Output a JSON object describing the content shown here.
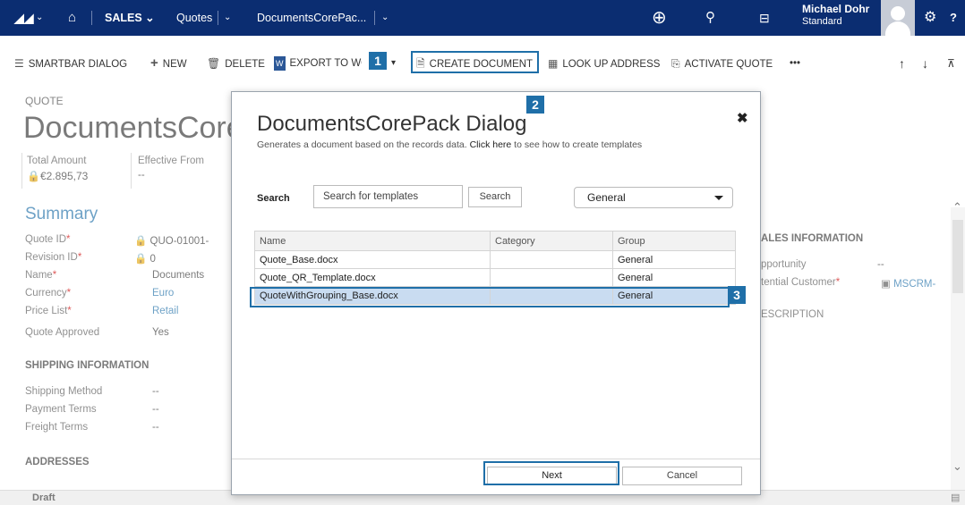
{
  "topnav": {
    "logo": "dynamics-logo",
    "home": "home-icon",
    "area": "SALES",
    "entity": "Quotes",
    "record": "DocumentsCorePac...",
    "user_name": "Michael Dohr",
    "user_role": "Standard"
  },
  "commandbar": {
    "smartbar": "SMARTBAR DIALOG",
    "new": "NEW",
    "delete": "DELETE",
    "export": "EXPORT TO WO",
    "create_document": "CREATE DOCUMENT",
    "lookup_address": "LOOK UP ADDRESS",
    "activate_quote": "ACTIVATE QUOTE",
    "more": "•••"
  },
  "callouts": {
    "one": "1",
    "two": "2",
    "three": "3"
  },
  "record": {
    "type_label": "QUOTE",
    "title": "DocumentsCore",
    "total_amount_label": "Total Amount",
    "total_amount_value": "€2.895,73",
    "effective_from_label": "Effective From",
    "effective_from_value": "--"
  },
  "summary": {
    "heading": "Summary",
    "fields": [
      {
        "label": "Quote ID",
        "value": "QUO-01001-"
      },
      {
        "label": "Revision ID",
        "value": "0"
      },
      {
        "label": "Name",
        "value": "Documents"
      },
      {
        "label": "Currency",
        "value": "Euro"
      },
      {
        "label": "Price List",
        "value": "Retail"
      },
      {
        "label": "Quote Approved",
        "value": "Yes"
      }
    ]
  },
  "shipping": {
    "heading": "SHIPPING INFORMATION",
    "fields": [
      {
        "label": "Shipping Method",
        "value": "--"
      },
      {
        "label": "Payment Terms",
        "value": "--"
      },
      {
        "label": "Freight Terms",
        "value": "--"
      }
    ]
  },
  "addresses": {
    "heading": "ADDRESSES"
  },
  "sales_info": {
    "heading": "ALES INFORMATION",
    "opportunity_label": "pportunity",
    "opportunity_value": "--",
    "customer_label": "tential Customer",
    "customer_value": "MSCRM-",
    "description_heading": "ESCRIPTION"
  },
  "status": {
    "text": "Draft"
  },
  "dialog": {
    "title": "DocumentsCorePack Dialog",
    "subtitle_pre": "Generates a document based on the records data. ",
    "subtitle_link": "Click here",
    "subtitle_post": " to see how to create templates",
    "search_label": "Search",
    "search_placeholder": "Search for templates",
    "search_button": "Search",
    "group_select": "General",
    "columns": [
      "Name",
      "Category",
      "Group"
    ],
    "rows": [
      {
        "name": "Quote_Base.docx",
        "category": "",
        "group": "General"
      },
      {
        "name": "Quote_QR_Template.docx",
        "category": "",
        "group": "General"
      },
      {
        "name": "QuoteWithGrouping_Base.docx",
        "category": "",
        "group": "General"
      }
    ],
    "next": "Next",
    "cancel": "Cancel"
  }
}
